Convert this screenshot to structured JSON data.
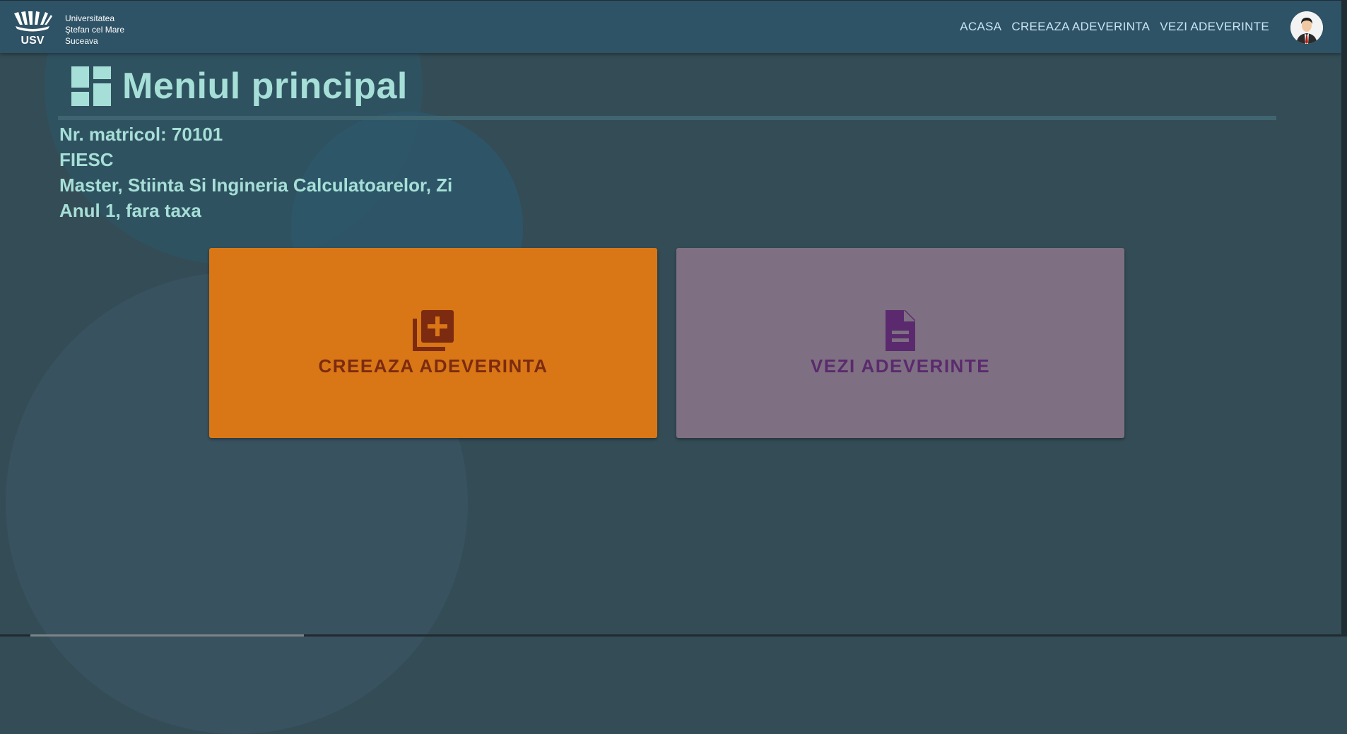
{
  "navbar": {
    "logo_text": "USV",
    "university_lines": [
      "Universitatea",
      "Ştefan cel Mare",
      "Suceava"
    ],
    "links": [
      "ACASA",
      "CREEAZA ADEVERINTA",
      "VEZI ADEVERINTE"
    ]
  },
  "page": {
    "title": "Meniul principal",
    "title_icon": "dashboard-icon"
  },
  "student": {
    "matricol": "Nr. matricol: 70101",
    "faculty": "FIESC",
    "program": "Master, Stiinta Si Ingineria Calculatoarelor, Zi",
    "year": "Anul 1, fara taxa"
  },
  "cards": [
    {
      "label": "CREEAZA ADEVERINTA",
      "icon": "library-add-icon",
      "color": "#d97716"
    },
    {
      "label": "VEZI ADEVERINTE",
      "icon": "document-icon",
      "color": "#7e7082"
    }
  ]
}
